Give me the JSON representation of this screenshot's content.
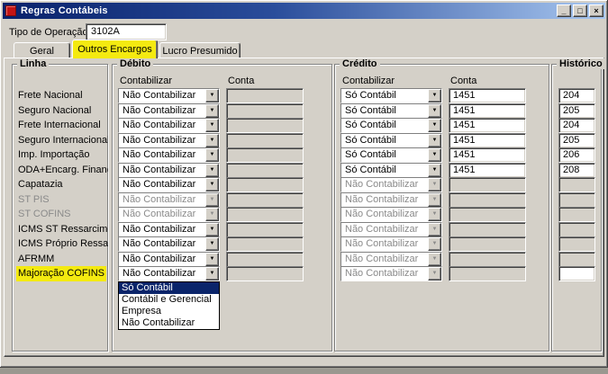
{
  "window": {
    "title": "Regras Contábeis",
    "controls": {
      "minimize": "_",
      "maximize": "□",
      "close": "×"
    }
  },
  "form": {
    "tipo_operacao_label": "Tipo de Operação",
    "tipo_operacao_value": "3102A"
  },
  "tabs": [
    {
      "label": "Geral",
      "active": false
    },
    {
      "label": "Outros Encargos",
      "active": true,
      "highlighted": true
    },
    {
      "label": "Lucro Presumido",
      "active": false
    }
  ],
  "columns": {
    "linha": "Linha",
    "debito": "Débito",
    "credito": "Crédito",
    "historico": "Histórico",
    "contabilizar": "Contabilizar",
    "conta": "Conta"
  },
  "icons": {
    "dropdown_arrow": "▼"
  },
  "colors": {
    "highlight_yellow": "#f4ea10",
    "titlebar_blue": "#08216b",
    "selection_navy": "#0a246a",
    "window_gray": "#d4d0c8"
  },
  "rows": [
    {
      "linha": "Frete Nacional",
      "debito": "Não Contabilizar",
      "debito_conta": "",
      "credito": "Só Contábil",
      "credito_conta": "1451",
      "historico": "204",
      "historico_disabled": false
    },
    {
      "linha": "Seguro Nacional",
      "debito": "Não Contabilizar",
      "debito_conta": "",
      "credito": "Só Contábil",
      "credito_conta": "1451",
      "historico": "205",
      "historico_disabled": false
    },
    {
      "linha": "Frete Internacional",
      "debito": "Não Contabilizar",
      "debito_conta": "",
      "credito": "Só Contábil",
      "credito_conta": "1451",
      "historico": "204",
      "historico_disabled": false
    },
    {
      "linha": "Seguro Internacional",
      "debito": "Não Contabilizar",
      "debito_conta": "",
      "credito": "Só Contábil",
      "credito_conta": "1451",
      "historico": "205",
      "historico_disabled": false
    },
    {
      "linha": "Imp. Importação",
      "debito": "Não Contabilizar",
      "debito_conta": "",
      "credito": "Só Contábil",
      "credito_conta": "1451",
      "historico": "206",
      "historico_disabled": false
    },
    {
      "linha": "ODA+Encarg. Financ.",
      "debito": "Não Contabilizar",
      "debito_conta": "",
      "credito": "Só Contábil",
      "credito_conta": "1451",
      "historico": "208",
      "historico_disabled": false
    },
    {
      "linha": "Capatazia",
      "debito": "Não Contabilizar",
      "debito_conta": "",
      "credito": "Não Contabilizar",
      "credito_disabled": true,
      "credito_conta": "",
      "historico": "",
      "historico_disabled": true
    },
    {
      "linha": "ST PIS",
      "linha_disabled": true,
      "debito": "Não Contabilizar",
      "debito_disabled": true,
      "debito_conta": "",
      "credito": "Não Contabilizar",
      "credito_disabled": true,
      "credito_conta": "",
      "historico": "",
      "historico_disabled": true
    },
    {
      "linha": "ST COFINS",
      "linha_disabled": true,
      "debito": "Não Contabilizar",
      "debito_disabled": true,
      "debito_conta": "",
      "credito": "Não Contabilizar",
      "credito_disabled": true,
      "credito_conta": "",
      "historico": "",
      "historico_disabled": true
    },
    {
      "linha": "ICMS ST Ressarcimento",
      "debito": "Não Contabilizar",
      "debito_conta": "",
      "credito": "Não Contabilizar",
      "credito_disabled": true,
      "credito_conta": "",
      "historico": "",
      "historico_disabled": true
    },
    {
      "linha": "ICMS Próprio Ressarcimento",
      "debito": "Não Contabilizar",
      "debito_conta": "",
      "credito": "Não Contabilizar",
      "credito_disabled": true,
      "credito_conta": "",
      "historico": "",
      "historico_disabled": true
    },
    {
      "linha": "AFRMM",
      "debito": "Não Contabilizar",
      "debito_conta": "",
      "credito": "Não Contabilizar",
      "credito_disabled": true,
      "credito_conta": "",
      "historico": "",
      "historico_disabled": true
    },
    {
      "linha": "Majoração COFINS",
      "linha_highlight": true,
      "debito": "Não Contabilizar",
      "debito_conta": "",
      "credito": "Não Contabilizar",
      "credito_disabled": true,
      "credito_conta": "",
      "historico": "",
      "historico_disabled": false
    }
  ],
  "open_dropdown": {
    "row_index": 12,
    "column": "debito",
    "highlighted": "Só Contábil",
    "options": [
      "Só Contábil",
      "Contábil e Gerencial",
      "Empresa",
      "Não Contabilizar"
    ]
  }
}
